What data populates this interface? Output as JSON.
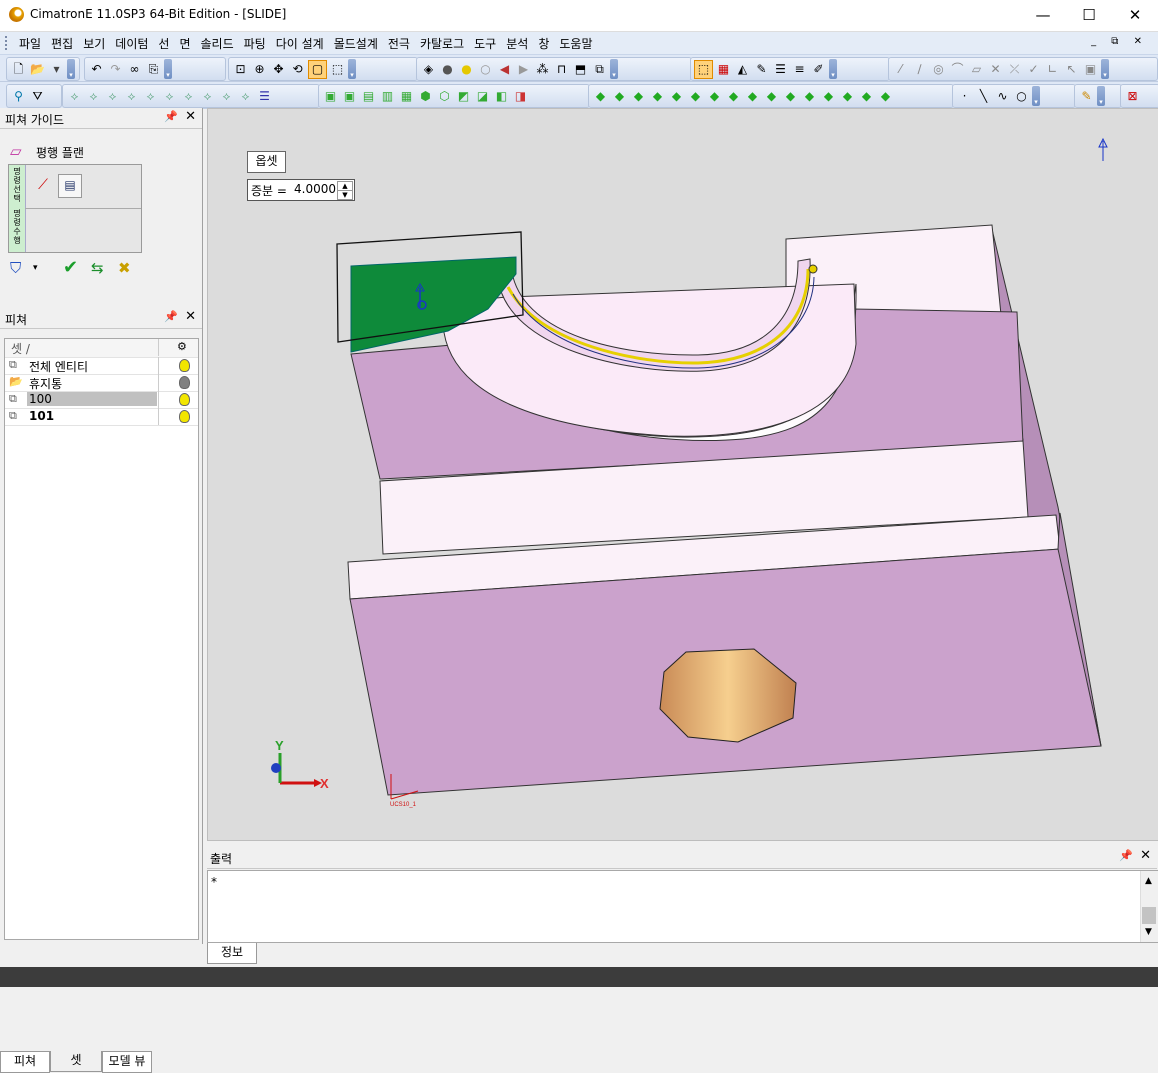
{
  "window": {
    "title": "CimatronE 11.0SP3 64-Bit Edition - [SLIDE]",
    "minimize": "—",
    "maximize": "☐",
    "close": "✕"
  },
  "menu": [
    "파일",
    "편집",
    "보기",
    "데이텀",
    "선",
    "면",
    "솔리드",
    "파팅",
    "다이 설계",
    "몰드설계",
    "전극",
    "카탈로그",
    "도구",
    "분석",
    "창",
    "도움말"
  ],
  "mdi_controls": "_ ⧉ ✕",
  "feature_guide": {
    "title": "피쳐 가이드",
    "command": "평행 플랜",
    "side_label_1": "명령선택",
    "side_label_2": "명령수행"
  },
  "feature_panel": {
    "title": "피쳐",
    "column_set": "셋 /",
    "rows": [
      {
        "label": "전체 엔티티",
        "bold": false,
        "bulb": "#f2e600"
      },
      {
        "label": "휴지통",
        "bold": false,
        "bulb": "#808080"
      },
      {
        "label": "100",
        "bold": false,
        "bulb": "#f2e600",
        "selected": true
      },
      {
        "label": "101",
        "bold": true,
        "bulb": "#f2e600"
      }
    ]
  },
  "left_tabs": [
    "피쳐",
    "셋",
    "모델 뷰"
  ],
  "viewport": {
    "offset_label": "옵셋",
    "offset_field_label": "증분 =",
    "offset_value": "4.0000",
    "axis_x": "X",
    "axis_y": "Y",
    "ucs_label": "UCS10_1"
  },
  "output": {
    "title": "출력",
    "text": "*"
  },
  "output_tabs": [
    "정보"
  ],
  "colors": {
    "part_face": "#cba2cc",
    "part_top": "#fbf1f9",
    "selected_face": "#0e8a3a",
    "hole": "#e2b07a"
  }
}
